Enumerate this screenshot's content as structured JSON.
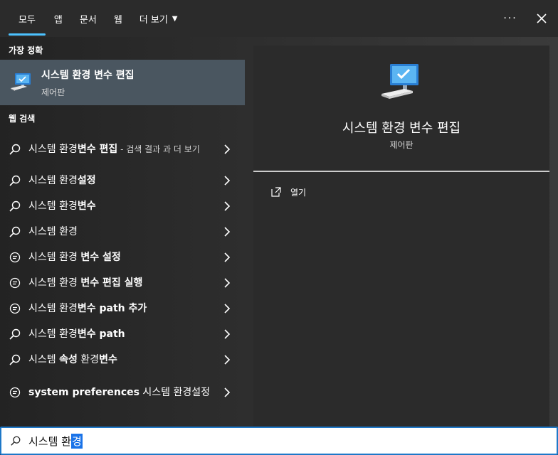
{
  "tabs": [
    {
      "label": "모두",
      "active": true
    },
    {
      "label": "앱"
    },
    {
      "label": "문서"
    },
    {
      "label": "웹"
    },
    {
      "label": "더 보기"
    }
  ],
  "top_actions": {
    "more_icon": "ellipsis-icon",
    "close_icon": "close-icon"
  },
  "best_match": {
    "section_title": "가장 정확",
    "title": "시스템 환경 변수 편집",
    "subtitle": "제어판",
    "icon": "system-properties-icon"
  },
  "web_section_title": "웹 검색",
  "results": [
    {
      "icon": "search-icon",
      "pre": "시스템 환경",
      "bold": "변수 편집",
      "post": "",
      "suffix": " - 검색 결과 과 더 보기"
    },
    {
      "icon": "search-icon",
      "pre": "시스템 환경",
      "bold": "설정",
      "post": "",
      "suffix": ""
    },
    {
      "icon": "search-icon",
      "pre": "시스템 환경",
      "bold": "변수",
      "post": "",
      "suffix": ""
    },
    {
      "icon": "search-icon",
      "pre": "시스템 환경",
      "bold": "",
      "post": "",
      "suffix": ""
    },
    {
      "icon": "chat-icon",
      "pre": "시스템 환경 ",
      "bold": "변수 설정",
      "post": "",
      "suffix": ""
    },
    {
      "icon": "chat-icon",
      "pre": "시스템 환경 ",
      "bold": "변수 편집 실행",
      "post": "",
      "suffix": ""
    },
    {
      "icon": "chat-icon",
      "pre": "시스템 환경",
      "bold": "변수 path 추가",
      "post": "",
      "suffix": ""
    },
    {
      "icon": "search-icon",
      "pre": "시스템 환경",
      "bold": "변수 path",
      "post": "",
      "suffix": ""
    },
    {
      "icon": "search-icon",
      "pre": "시스템 ",
      "bold": "속성",
      "post": " 환경",
      "bold2": "변수",
      "suffix": ""
    },
    {
      "icon": "chat-icon",
      "pre": "",
      "bold": "system preferences",
      "post": " 시스템 환경설정",
      "suffix": ""
    }
  ],
  "detail": {
    "title": "시스템 환경 변수 편집",
    "subtitle": "제어판",
    "open_label": "열기",
    "open_icon": "open-icon"
  },
  "search": {
    "value_plain": "시스템 환",
    "value_selected": "경",
    "icon": "search-icon"
  },
  "colors": {
    "accent": "#4cc2ff",
    "selected_item_bg": "#4a5660",
    "search_border": "#1e78c8",
    "selection": "#1a73e8"
  }
}
